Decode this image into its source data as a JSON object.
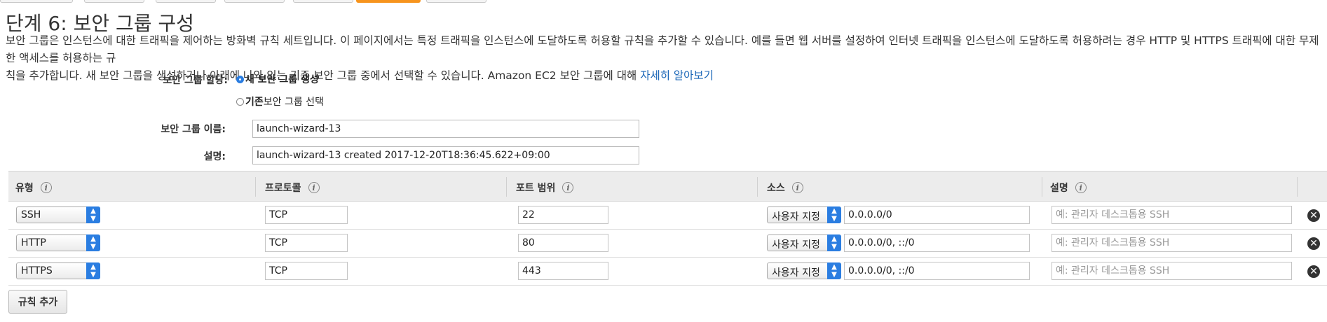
{
  "page": {
    "title": "단계 6: 보안 그룹 구성",
    "description_line1": "보안 그룹은 인스턴스에 대한 트래픽을 제어하는 방화벽 규칙 세트입니다. 이 페이지에서는 특정 트래픽을 인스턴스에 도달하도록 허용할 규칙을 추가할 수 있습니다. 예를 들면 웹 서버를 설정하여 인터넷 트래픽을 인스턴스에 도달하도록 허용하려는 경우 HTTP 및 HTTPS 트래픽에 대한 무제한 액세스를 허용하는 규",
    "description_line2": "칙을 추가합니다. 새 보안 그룹을 생성하거나 아래에 나와 있는 기존 보안 그룹 중에서 선택할 수 있습니다. Amazon EC2 보안 그룹에 대해",
    "learn_more": "자세히 알아보기"
  },
  "form": {
    "assign_label": "보안 그룹 할당:",
    "option_new": "새 보안 그룹 생성",
    "option_existing_bold": "기존",
    "option_existing_rest": " 보안 그룹 선택",
    "name_label": "보안 그룹 이름:",
    "name_value": "launch-wizard-13",
    "desc_label": "설명:",
    "desc_value": "launch-wizard-13 created 2017-12-20T18:36:45.622+09:00"
  },
  "table": {
    "headers": {
      "type": "유형",
      "protocol": "프로토콜",
      "port": "포트 범위",
      "source": "소스",
      "description": "설명"
    },
    "info_glyph": "i",
    "desc_placeholder": "예: 관리자 데스크톱용 SSH",
    "source_select": "사용자 지정",
    "rows": [
      {
        "type": "SSH",
        "protocol": "TCP",
        "port": "22",
        "source": "0.0.0.0/0"
      },
      {
        "type": "HTTP",
        "protocol": "TCP",
        "port": "80",
        "source": "0.0.0.0/0, ::/0"
      },
      {
        "type": "HTTPS",
        "protocol": "TCP",
        "port": "443",
        "source": "0.0.0.0/0, ::/0"
      }
    ]
  },
  "actions": {
    "add_rule": "규칙 추가",
    "remove_glyph": "✕"
  },
  "colors": {
    "accent_blue": "#2a7de1",
    "link_blue": "#1a66b7",
    "active_tab": "#f7941d"
  }
}
